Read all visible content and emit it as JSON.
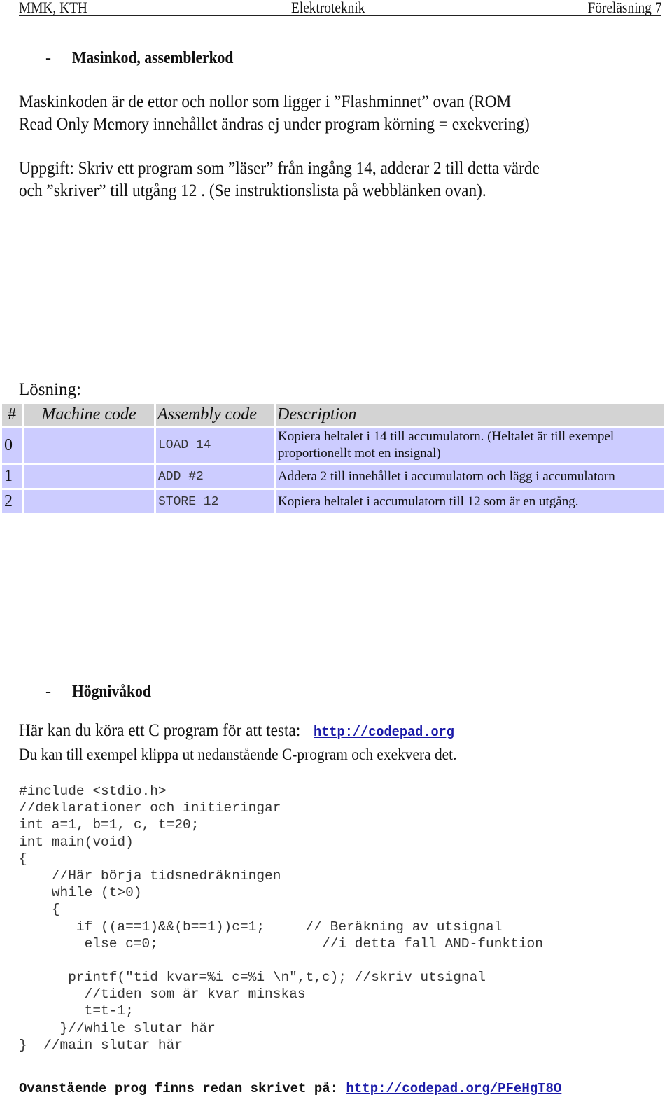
{
  "header": {
    "left": "MMK, KTH",
    "center": "Elektroteknik",
    "right": "Föreläsning 7"
  },
  "section1": {
    "bullet": "-",
    "title": "Masinkod, assemblerkod"
  },
  "paragraph1": [
    "Maskinkoden är de ettor och nollor som ligger i ”Flashminnet” ovan (ROM",
    "Read Only Memory innehållet ändras ej under program körning = exekvering)"
  ],
  "task": [
    "Uppgift: Skriv ett program som ”läser” från ingång 14, adderar 2 till detta värde",
    "och ”skriver” till utgång 12 . (Se instruktionslista på webblänken ovan)."
  ],
  "solution_label": "Lösning:",
  "table": {
    "headers": [
      "#",
      "Machine code",
      "Assembly code",
      "Description"
    ],
    "rows": [
      {
        "num": "0",
        "machine": "",
        "assembly": "LOAD 14",
        "description": "Kopiera heltalet i 14 till accumulatorn.  (Heltalet är till exempel proportionellt mot en insignal)"
      },
      {
        "num": "1",
        "machine": "",
        "assembly": "ADD #2",
        "description": "Addera 2 till innehållet i accumulatorn och lägg i accumulatorn"
      },
      {
        "num": "2",
        "machine": "",
        "assembly": "STORE 12",
        "description": "Kopiera heltalet i accumulatorn till 12 som är en utgång."
      }
    ],
    "colors": {
      "header_bg": "#d3d3d3",
      "row_bg": "#ccccff"
    }
  },
  "section2": {
    "bullet": "-",
    "title": "Högnivåkod"
  },
  "intro": {
    "line1_text": "Här kan du köra ett C program för att testa:",
    "line1_link": "http://codepad.org",
    "line2": "Du kan till exempel klippa ut nedanstående C-program och exekvera det."
  },
  "code_lines": [
    "#include <stdio.h>",
    "//deklarationer och initieringar",
    "int a=1, b=1, c, t=20;",
    "int main(void)",
    "{",
    "    //Här börja tidsnedräkningen",
    "    while (t>0)",
    "    {",
    "       if ((a==1)&&(b==1))c=1;     // Beräkning av utsignal",
    "        else c=0;                    //i detta fall AND-funktion",
    "",
    "      printf(\"tid kvar=%i c=%i \\n\",t,c); //skriv utsignal",
    "        //tiden som är kvar minskas",
    "        t=t-1;",
    "     }//while slutar här",
    "}  //main slutar här"
  ],
  "footer": {
    "text": "Ovanstående prog finns redan skrivet på:",
    "link": "http://codepad.org/PFeHgT8O"
  },
  "colors": {
    "link": "#1a1aa8"
  }
}
